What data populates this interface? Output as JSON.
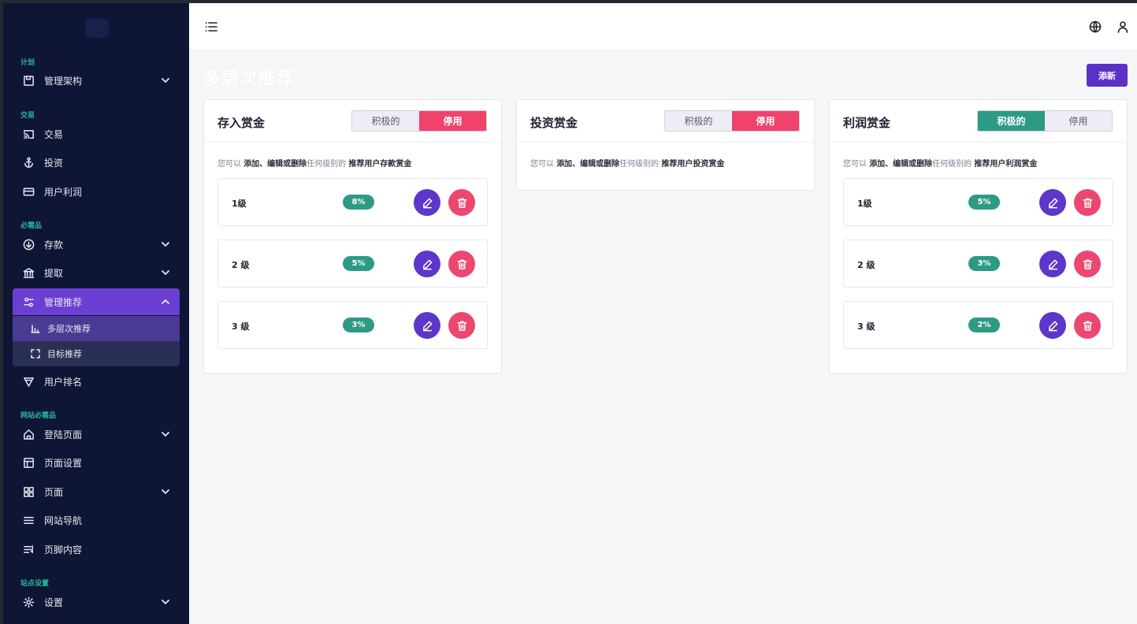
{
  "sidebar": {
    "sections": {
      "plan": "计划",
      "trade": "交易",
      "essentials": "必需品",
      "site_essentials": "网站必需品",
      "site_settings": "站点设置"
    },
    "items": {
      "manage_structure": "管理架构",
      "transaction": "交易",
      "investment": "投资",
      "user_profit": "用户利润",
      "deposit": "存款",
      "withdraw": "提取",
      "manage_referral": "管理推荐",
      "multilevel_referral": "多层次推荐",
      "target_referral": "目标推荐",
      "user_ranking": "用户排名",
      "landing_page": "登陆页面",
      "page_settings": "页面设置",
      "pages": "页面",
      "site_navigation": "网站导航",
      "footer_content": "页脚内容",
      "settings": "设置"
    }
  },
  "page": {
    "title": "多层次推荐",
    "add_label": "添新"
  },
  "toggle": {
    "active": "积极的",
    "disabled": "停用"
  },
  "desc": {
    "prefix": "您可以",
    "actions": "添加、编辑或删除",
    "middle": "任何级别的",
    "end_prefix": "推荐用户"
  },
  "cards": [
    {
      "title": "存入赏金",
      "state": "disabled",
      "desc_target": "存款赏金",
      "levels": [
        {
          "name": "1级",
          "pct": "8%"
        },
        {
          "name": "2 级",
          "pct": "5%"
        },
        {
          "name": "3 级",
          "pct": "3%"
        }
      ]
    },
    {
      "title": "投资赏金",
      "state": "disabled",
      "desc_target": "投资赏金",
      "levels": []
    },
    {
      "title": "利润赏金",
      "state": "active",
      "desc_target": "利润赏金",
      "levels": [
        {
          "name": "1级",
          "pct": "5%"
        },
        {
          "name": "2 级",
          "pct": "3%"
        },
        {
          "name": "3 级",
          "pct": "2%"
        }
      ]
    }
  ],
  "colors": {
    "sidebar_bg": "#0f1535",
    "accent_purple": "#5b32c7",
    "active_green": "#2d9a86",
    "disabled_red": "#f0426b"
  }
}
